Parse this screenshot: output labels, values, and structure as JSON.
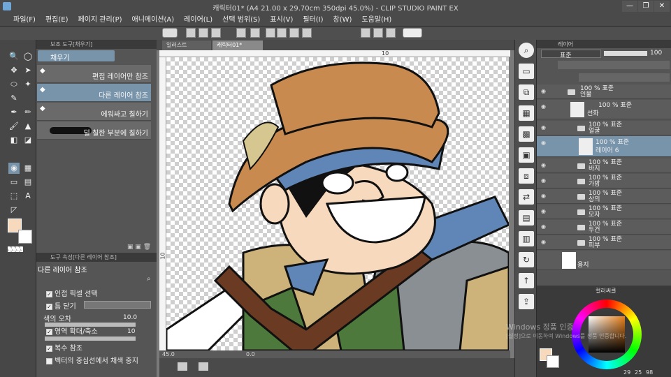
{
  "window": {
    "title": "캐릭터01* (A4 21.00 x 29.70cm 350dpi 45.0%) - CLIP STUDIO PAINT EX",
    "min": "—",
    "restore": "❐",
    "close": "✕"
  },
  "menu": [
    "파일(F)",
    "편집(E)",
    "페이지 관리(P)",
    "애니메이션(A)",
    "레이어(L)",
    "선택 범위(S)",
    "표시(V)",
    "필터(I)",
    "창(W)",
    "도움말(H)"
  ],
  "doc_tabs": [
    "일러스트",
    "캐릭터01*"
  ],
  "ruler": {
    "h_mark": "10",
    "v_mark": "10"
  },
  "subtool_panel": {
    "header": "보조 도구[채우기]",
    "tab": "채우기",
    "items": [
      "편집 레이어만 참조",
      "다른 레이어 참조",
      "에워싸고 칠하기",
      "덜 칠한 부분에 칠하기"
    ],
    "selected_index": 1
  },
  "tool_property": {
    "header": "도구 속성[다른 레이어 참조]",
    "title": "다른 레이어 참조",
    "rows": {
      "adjacent_pixel": "인접 픽셀 선택",
      "close_gap": "틈 닫기",
      "tolerance_label": "색의 오차",
      "tolerance_value": "10.0",
      "area_scale": "영역 확대/축소",
      "area_scale_value": "10",
      "multi_ref": "복수 참조",
      "vector_stop": "벡터의 중심선에서 채색 중지"
    }
  },
  "canvas_status": {
    "zoom": "45.0",
    "angle": "0.0"
  },
  "layer_panel": {
    "tab": "레이어",
    "blend_mode": "표준",
    "opacity": "100",
    "layers": [
      {
        "pct": "100 % 표준",
        "name": "인물",
        "type": "folder"
      },
      {
        "pct": "100 % 표준",
        "name": "선화",
        "type": "layer"
      },
      {
        "pct": "100 % 표준",
        "name": "얼굴",
        "type": "folder"
      },
      {
        "pct": "100 % 표준",
        "name": "레이어 6",
        "type": "layer",
        "selected": true
      },
      {
        "pct": "100 % 표준",
        "name": "바지",
        "type": "folder"
      },
      {
        "pct": "100 % 표준",
        "name": "가방",
        "type": "folder"
      },
      {
        "pct": "100 % 표준",
        "name": "상의",
        "type": "folder"
      },
      {
        "pct": "100 % 표준",
        "name": "모자",
        "type": "folder"
      },
      {
        "pct": "100 % 표준",
        "name": "두건",
        "type": "folder"
      },
      {
        "pct": "100 % 표준",
        "name": "피부",
        "type": "folder"
      },
      {
        "pct": "",
        "name": "용지",
        "type": "paper"
      }
    ]
  },
  "color_panel": {
    "tab": "컬러써클",
    "hsv": [
      "29",
      "25",
      "98"
    ],
    "main_color": "#f7d9be",
    "sub_color": "#ffffff"
  },
  "watermark": {
    "line1": "Windows 정품 인증",
    "line2": "[설정]으로 이동하여 Windows를 정품 인증합니다."
  },
  "colors": {
    "accent": "#7894aa",
    "skin": "#f7d9be",
    "hat": "#c98a4f",
    "bandana": "#5f86b6",
    "shirt": "#cdb27a",
    "vest": "#4d7a3c",
    "bag": "#8a8f93",
    "strap": "#6a3b22"
  }
}
